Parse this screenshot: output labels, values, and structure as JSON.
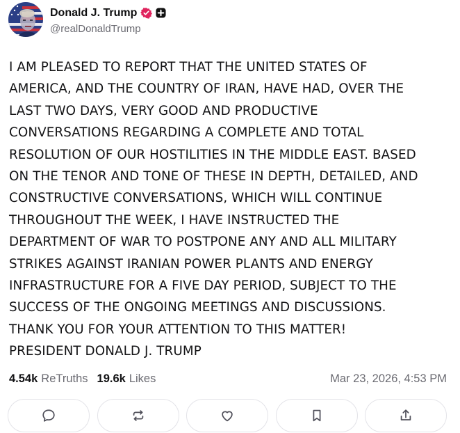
{
  "author": {
    "display_name": "Donald J. Trump",
    "handle": "@realDonaldTrump",
    "avatar_icon": "flag-portrait-avatar",
    "verified_icon": "verified-badge-icon",
    "verified_color": "#e0245e",
    "extra_icon": "plus-square-icon"
  },
  "post": {
    "lines": [
      "I AM PLEASED TO REPORT THAT THE UNITED STATES OF",
      "AMERICA, AND THE COUNTRY OF IRAN, HAVE HAD, OVER THE",
      "LAST TWO DAYS, VERY GOOD AND PRODUCTIVE",
      "CONVERSATIONS REGARDING A COMPLETE AND TOTAL",
      "RESOLUTION OF OUR HOSTILITIES IN THE MIDDLE EAST. BASED",
      "ON THE TENOR AND TONE OF THESE IN DEPTH, DETAILED, AND",
      "CONSTRUCTIVE CONVERSATIONS, WHICH WILL CONTINUE",
      "THROUGHOUT THE WEEK, I HAVE INSTRUCTED THE",
      "DEPARTMENT OF WAR TO POSTPONE ANY AND ALL MILITARY",
      "STRIKES AGAINST IRANIAN POWER PLANTS AND ENERGY",
      "INFRASTRUCTURE FOR A FIVE DAY PERIOD, SUBJECT TO THE",
      "SUCCESS OF THE ONGOING MEETINGS AND DISCUSSIONS.",
      "THANK YOU FOR YOUR ATTENTION TO THIS MATTER!",
      "PRESIDENT DONALD J. TRUMP"
    ]
  },
  "stats": {
    "retruths_count": "4.54k",
    "retruths_label": "ReTruths",
    "likes_count": "19.6k",
    "likes_label": "Likes",
    "timestamp": "Mar 23, 2026, 4:53 PM"
  },
  "actions": [
    {
      "name": "reply",
      "icon": "speech-bubble-icon"
    },
    {
      "name": "retruth",
      "icon": "repost-arrows-icon"
    },
    {
      "name": "like",
      "icon": "heart-icon"
    },
    {
      "name": "bookmark",
      "icon": "bookmark-icon"
    },
    {
      "name": "share",
      "icon": "share-upload-icon"
    }
  ]
}
